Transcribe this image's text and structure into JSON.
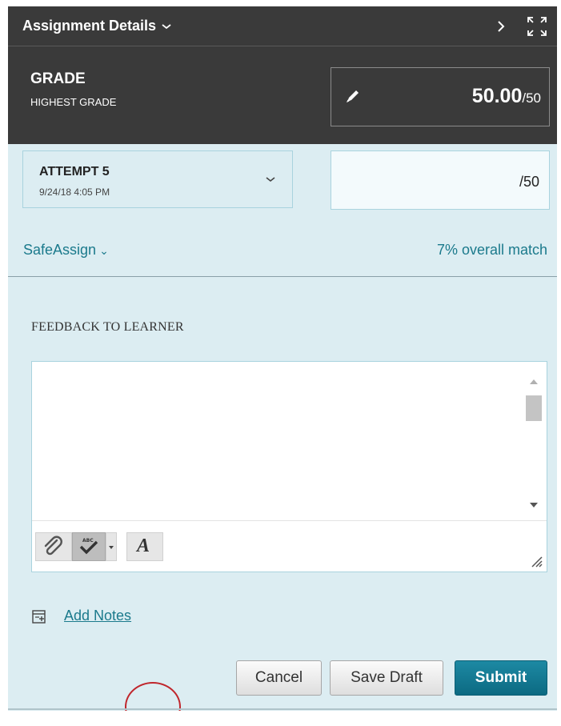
{
  "header": {
    "title": "Assignment Details",
    "title_chevron_icon": "chevron-down-icon",
    "next_icon": "chevron-right-icon",
    "expand_icon": "expand-icon"
  },
  "grade": {
    "label": "GRADE",
    "sublabel": "HIGHEST GRADE",
    "value": "50.00",
    "out_of": "/50",
    "edit_icon": "pencil-icon"
  },
  "attempt": {
    "title": "ATTEMPT 5",
    "date": "9/24/18 4:05 PM",
    "dropdown_icon": "chevron-down-icon"
  },
  "attempt_score": {
    "value": "",
    "out_of": "/50"
  },
  "safeassign": {
    "label": "SafeAssign",
    "chevron": "⌄",
    "match": "7% overall match"
  },
  "feedback": {
    "label": "FEEDBACK TO LEARNER",
    "text": "",
    "toolbar": {
      "attach_icon": "paperclip-icon",
      "spellcheck_icon": "spellcheck-icon",
      "format_label": "A",
      "format_icon": "text-format-icon"
    }
  },
  "notes": {
    "label": "Add Notes",
    "icon": "add-note-icon"
  },
  "actions": {
    "cancel": "Cancel",
    "save_draft": "Save Draft",
    "submit": "Submit"
  },
  "colors": {
    "header_bg": "#3a3a3a",
    "panel_bg": "#dcedf2",
    "accent": "#1b7a8c",
    "submit_bg": "#0c6a82",
    "highlight_ring": "#c0262c"
  }
}
